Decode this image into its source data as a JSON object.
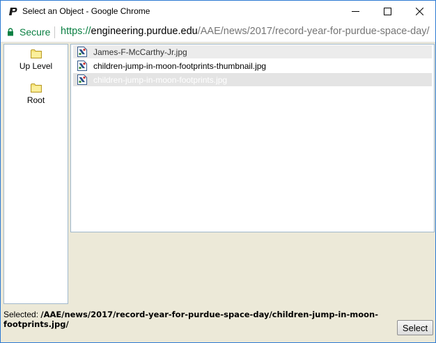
{
  "window": {
    "title": "Select an Object - Google Chrome",
    "controls": [
      "minimize",
      "maximize",
      "close"
    ]
  },
  "address_bar": {
    "secure_label": "Secure",
    "url_scheme": "https://",
    "url_host": "engineering.purdue.edu",
    "url_path": "/AAE/news/2017/record-year-for-purdue-space-day/"
  },
  "nav": {
    "up_level_label": "Up Level",
    "root_label": "Root"
  },
  "files": [
    {
      "name": "James-F-McCarthy-Jr.jpg",
      "icon": "image-file-icon"
    },
    {
      "name": "children-jump-in-moon-footprints-thumbnail.jpg",
      "icon": "image-file-icon"
    },
    {
      "name": "children-jump-in-moon-footprints.jpg",
      "icon": "image-file-icon"
    }
  ],
  "selection": {
    "label": "Selected:",
    "path": "/AAE/news/2017/record-year-for-purdue-space-day/children-jump-in-moon-footprints.jpg/"
  },
  "actions": {
    "select_label": "Select"
  },
  "colors": {
    "secure_green": "#0b8043",
    "dialog_background": "#ece9d8",
    "panel_border": "#a0b8cc",
    "window_border": "#2b79d3"
  }
}
